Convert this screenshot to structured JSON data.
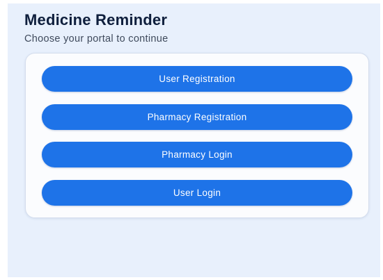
{
  "header": {
    "title": "Medicine Reminder",
    "subtitle": "Choose your portal to continue"
  },
  "portal_buttons": [
    {
      "label": "User Registration"
    },
    {
      "label": "Pharmacy Registration"
    },
    {
      "label": "Pharmacy Login"
    },
    {
      "label": "User Login"
    }
  ],
  "colors": {
    "background": "#e8f0fc",
    "card": "#fbfcfe",
    "button": "#1e73e8",
    "title_text": "#0f1f3d"
  }
}
